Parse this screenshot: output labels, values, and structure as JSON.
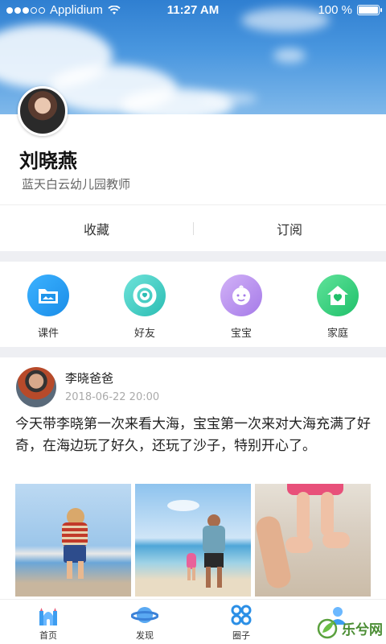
{
  "status_bar": {
    "carrier": "Applidium",
    "time": "11:27 AM",
    "battery": "100 %",
    "battery_level": 1.0
  },
  "profile": {
    "name": "刘晓燕",
    "title": "蓝天白云幼儿园教师"
  },
  "tabs": [
    {
      "label": "收藏"
    },
    {
      "label": "订阅"
    }
  ],
  "categories": [
    {
      "label": "课件",
      "icon": "folder-icon",
      "color": "#2aa0f0"
    },
    {
      "label": "好友",
      "icon": "lifebuoy-icon",
      "color": "#3fd0c8"
    },
    {
      "label": "宝宝",
      "icon": "baby-face-icon",
      "color": "#b98ff0"
    },
    {
      "label": "家庭",
      "icon": "home-heart-icon",
      "color": "#33d17a"
    }
  ],
  "post": {
    "author": "李晓爸爸",
    "time": "2018-06-22 20:00",
    "text": "今天带李晓第一次来看大海，宝宝第一次来对大海充满了好奇，在海边玩了好久，还玩了沙子，特别开心了。"
  },
  "nav": [
    {
      "label": "首页",
      "icon": "castle-icon"
    },
    {
      "label": "发现",
      "icon": "planet-icon"
    },
    {
      "label": "圈子",
      "icon": "circles-icon"
    }
  ],
  "watermark": {
    "text": "乐兮网"
  }
}
